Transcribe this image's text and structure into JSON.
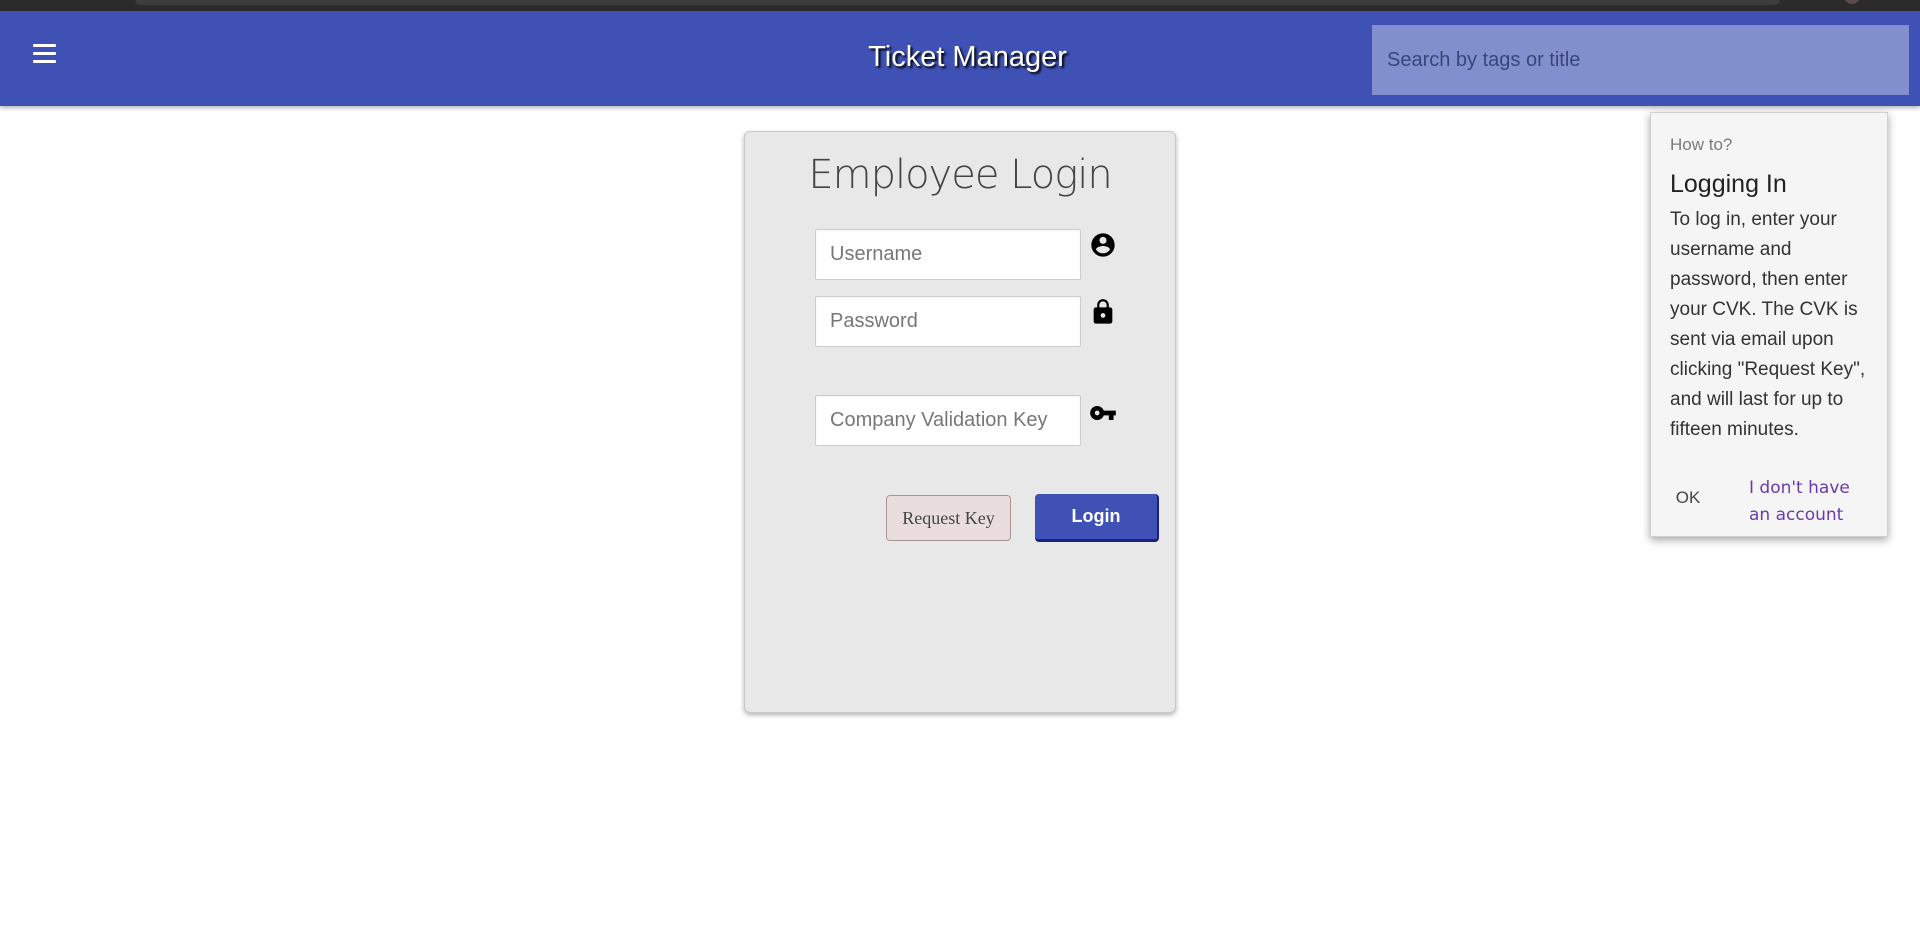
{
  "header": {
    "title": "Ticket Manager",
    "search_placeholder": "Search by tags or title",
    "menu_icon": "hamburger-menu-icon"
  },
  "login": {
    "title": "Employee Login",
    "username_placeholder": "Username",
    "password_placeholder": "Password",
    "cvk_placeholder": "Company Validation Key",
    "request_key_label": "Request Key",
    "login_label": "Login",
    "icons": {
      "username": "account-circle-icon",
      "password": "lock-icon",
      "cvk": "key-icon"
    }
  },
  "howto": {
    "subtitle": "How to?",
    "title": "Logging In",
    "body": "To log in, enter your username and password, then enter your CVK. The CVK is sent via email upon clicking \"Request Key\", and will last for up to fifteen minutes.",
    "ok_label": "OK",
    "no_account_label": "I don't have an account"
  },
  "colors": {
    "primary": "#3f51b5",
    "search_bg": "#8190cd",
    "card_bg": "#e8e8e8",
    "link": "#6a3aaa"
  }
}
